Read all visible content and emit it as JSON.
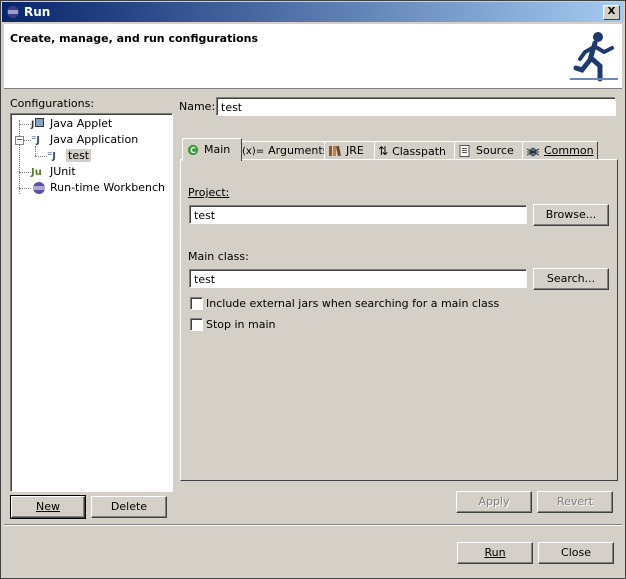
{
  "window": {
    "title": "Run",
    "close_label": "X",
    "banner_title": "Create, manage, and run configurations"
  },
  "configurations": {
    "label": "Configurations:",
    "tree": [
      {
        "label": "Java Applet",
        "level": 1
      },
      {
        "label": "Java Application",
        "level": 1,
        "expanded": true
      },
      {
        "label": "test",
        "level": 2,
        "selected": true
      },
      {
        "label": "JUnit",
        "level": 1
      },
      {
        "label": "Run-time Workbench",
        "level": 1
      }
    ],
    "new_label": "New",
    "delete_label": "Delete"
  },
  "name": {
    "label": "Name:",
    "value": "test"
  },
  "tabs": [
    {
      "label": "Main",
      "active": true,
      "icon": "c-icon"
    },
    {
      "label": "Arguments",
      "icon": "args-icon"
    },
    {
      "label": "JRE",
      "icon": "library-icon"
    },
    {
      "label": "Classpath",
      "icon": "classpath-icon"
    },
    {
      "label": "Source",
      "icon": "source-icon"
    },
    {
      "label": "Common",
      "icon": "bug-icon"
    }
  ],
  "main": {
    "project_label": "Project:",
    "project_value": "test",
    "browse_label": "Browse...",
    "main_class_label": "Main class:",
    "main_class_value": "test",
    "search_label": "Search...",
    "include_external_label": "Include external jars when searching for a main class",
    "include_external_checked": false,
    "stop_in_main_label": "Stop in main",
    "stop_in_main_checked": false
  },
  "actions": {
    "apply_label": "Apply",
    "revert_label": "Revert",
    "run_label": "Run",
    "close_label": "Close"
  },
  "icons": {
    "args_glyph": "(x)=",
    "classpath_glyph": "⇅",
    "java_glyph": "J",
    "applet_glyph": "J",
    "junit_glyph": "Ju"
  },
  "colors": {
    "title_start": "#08246b",
    "title_end": "#a6caf0",
    "face": "#d4d0c8",
    "runner": "#2f4f8f"
  }
}
